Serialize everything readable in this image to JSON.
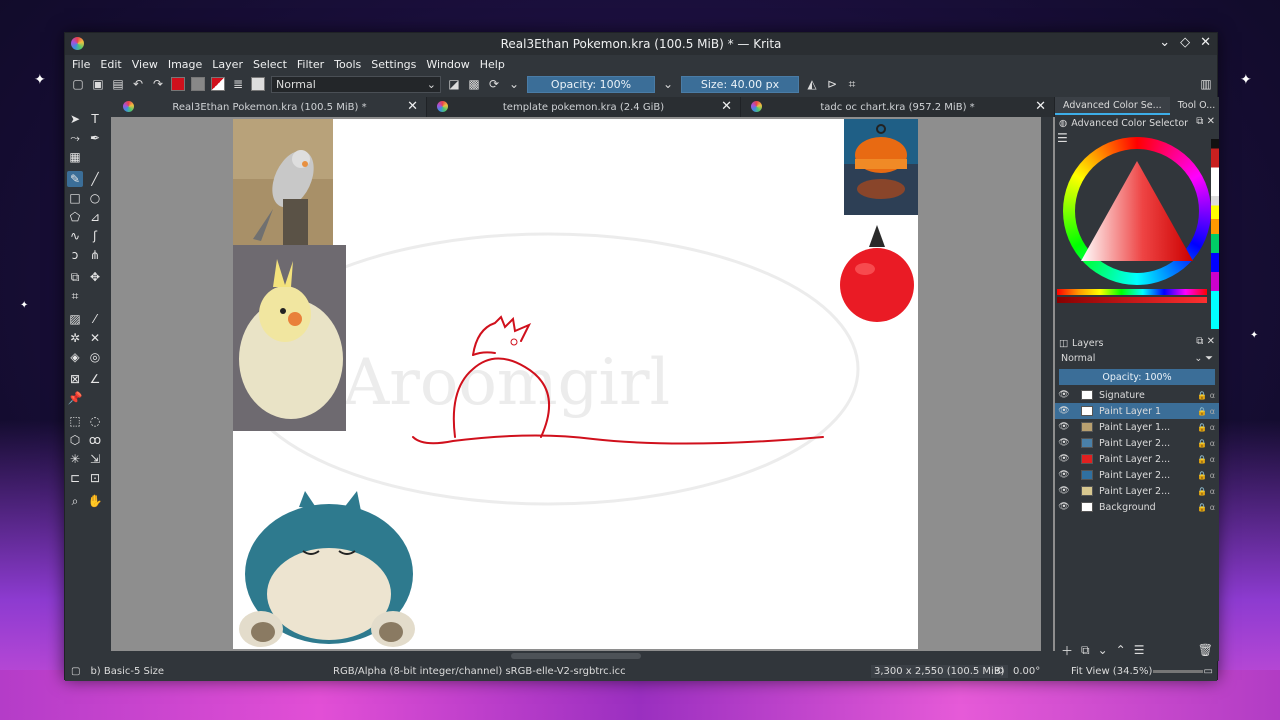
{
  "window": {
    "title": "Real3Ethan Pokemon.kra (100.5 MiB) * — Krita"
  },
  "menu": [
    "File",
    "Edit",
    "View",
    "Image",
    "Layer",
    "Select",
    "Filter",
    "Tools",
    "Settings",
    "Window",
    "Help"
  ],
  "toolbar": {
    "blend_mode": "Normal",
    "opacity": "Opacity: 100%",
    "size": "Size: 40.00 px"
  },
  "tabs": [
    {
      "label": "Real3Ethan Pokemon.kra (100.5 MiB) *",
      "active": true
    },
    {
      "label": "template pokemon.kra (2.4 GiB)",
      "active": false
    },
    {
      "label": "tadc oc chart.kra (957.2 MiB) *",
      "active": false
    }
  ],
  "canvas": {
    "watermark": "Aroomgirl"
  },
  "dock": {
    "tabs": [
      "Advanced Color Se...",
      "Tool O..."
    ],
    "color_panel_title": "Advanced Color Selector",
    "layers_title": "Layers",
    "blend_mode": "Normal",
    "opacity": "Opacity: 100%",
    "layers": [
      {
        "name": "Signature",
        "selected": false,
        "thumb": "#ffffff"
      },
      {
        "name": "Paint Layer 1",
        "selected": true,
        "thumb": "#ffffff"
      },
      {
        "name": "Paint Layer 1...",
        "selected": false,
        "thumb": "#b8a070"
      },
      {
        "name": "Paint Layer 2...",
        "selected": false,
        "thumb": "#4a80a8"
      },
      {
        "name": "Paint Layer 2...",
        "selected": false,
        "thumb": "#e02020"
      },
      {
        "name": "Paint Layer 2...",
        "selected": false,
        "thumb": "#3070a0"
      },
      {
        "name": "Paint Layer 2...",
        "selected": false,
        "thumb": "#d8c890"
      },
      {
        "name": "Background",
        "selected": false,
        "thumb": "#ffffff"
      }
    ]
  },
  "status": {
    "brush": "b) Basic-5 Size",
    "color_space": "RGB/Alpha (8-bit integer/channel)  sRGB-elle-V2-srgbtrc.icc",
    "dimensions": "3,300 x 2,550 (100.5 MiB)",
    "rotation": "0.00°",
    "zoom": "Fit View (34.5%)"
  },
  "colors": {
    "accent": "#3b6e98",
    "stroke": "#d0101c"
  }
}
